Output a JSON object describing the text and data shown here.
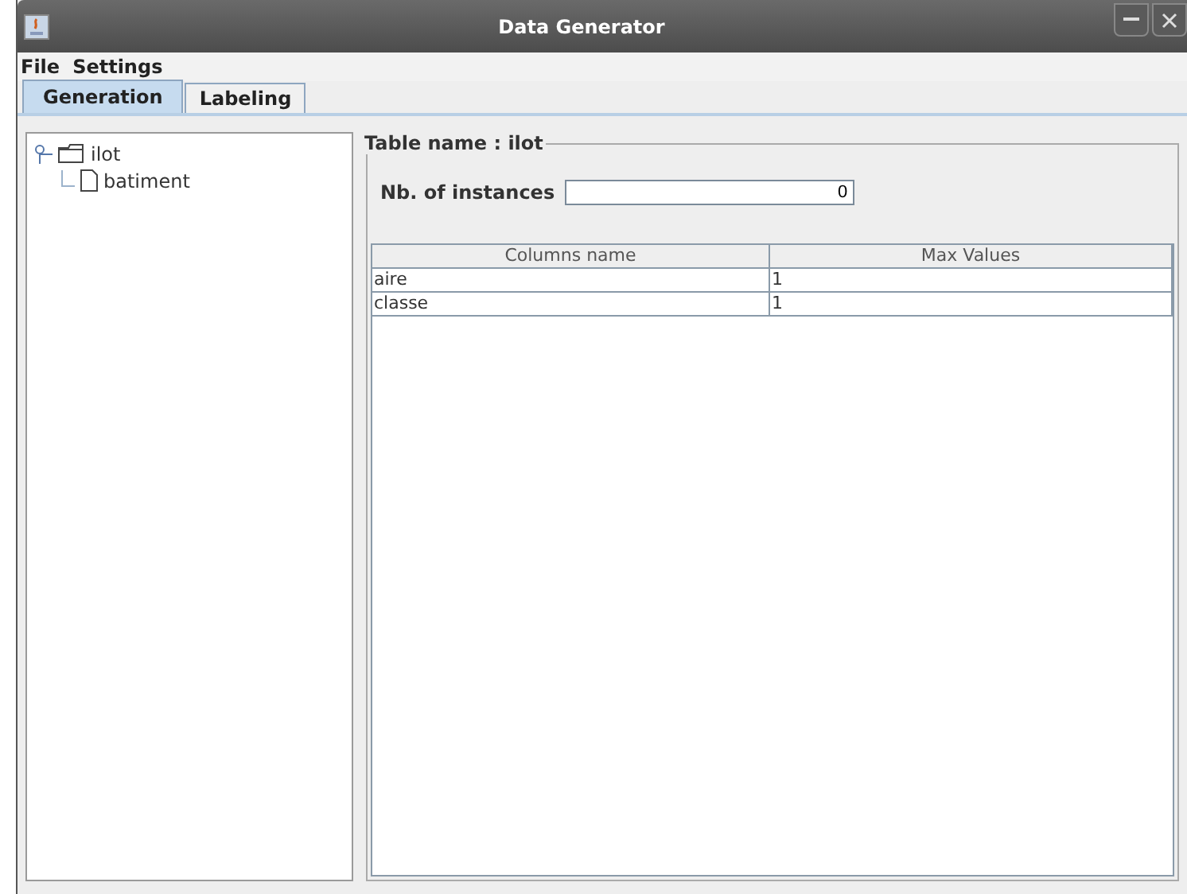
{
  "window": {
    "title": "Data Generator"
  },
  "menu": [
    "File",
    "Settings"
  ],
  "tabs": [
    {
      "label": "Generation",
      "selected": true
    },
    {
      "label": "Labeling",
      "selected": false
    }
  ],
  "tree": [
    {
      "label": "ilot",
      "expanded": true,
      "children": [
        {
          "label": "batiment"
        }
      ]
    }
  ],
  "panel": {
    "title": "Table name : ilot",
    "instances_label": "Nb. of instances",
    "instances_value": "0",
    "table": {
      "columns": [
        "Columns name",
        "Max Values"
      ],
      "rows": [
        [
          "aire",
          "1"
        ],
        [
          "classe",
          "1"
        ]
      ]
    }
  }
}
